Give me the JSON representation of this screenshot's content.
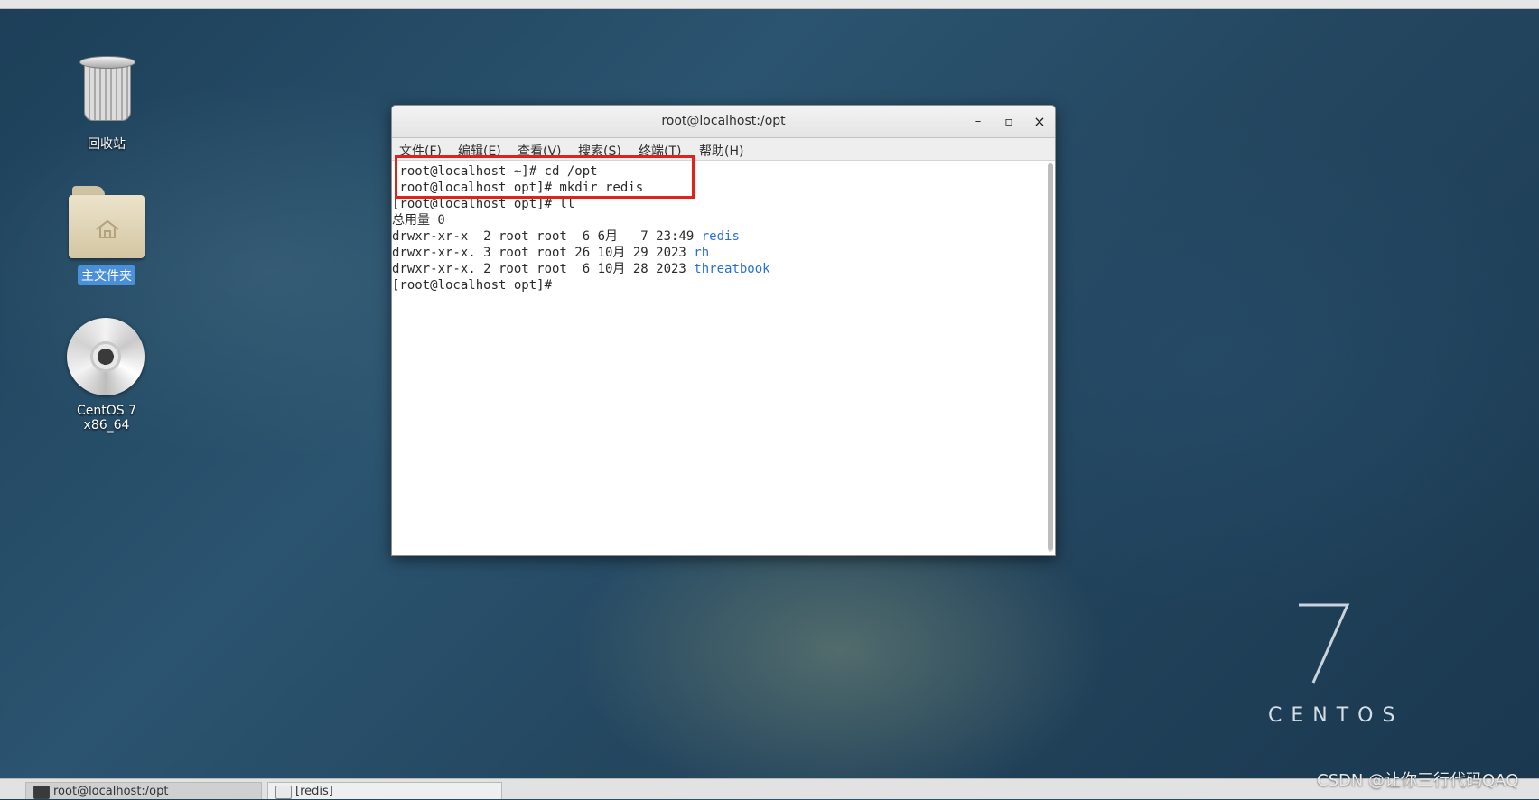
{
  "desktop": {
    "icons": [
      {
        "label": "回收站",
        "icon": "trash-icon"
      },
      {
        "label": "主文件夹",
        "icon": "home-folder-icon"
      },
      {
        "label": "CentOS 7 x86_64",
        "icon": "disc-icon"
      }
    ],
    "brand_number": "7",
    "brand_text": "CENTOS"
  },
  "window": {
    "title": "root@localhost:/opt",
    "controls": {
      "minimize": "–",
      "maximize": "▫",
      "close": "×"
    },
    "menu": [
      "文件(F)",
      "编辑(E)",
      "查看(V)",
      "搜索(S)",
      "终端(T)",
      "帮助(H)"
    ]
  },
  "terminal": {
    "lines": [
      "[root@localhost ~]# cd /opt",
      "[root@localhost opt]# mkdir redis",
      "[root@localhost opt]# ll",
      "总用量 0"
    ],
    "listing": [
      {
        "meta": "drwxr-xr-x  2 root root  6 6月   7 23:49 ",
        "name": "redis"
      },
      {
        "meta": "drwxr-xr-x. 3 root root 26 10月 29 2023 ",
        "name": "rh"
      },
      {
        "meta": "drwxr-xr-x. 2 root root  6 10月 28 2023 ",
        "name": "threatbook"
      }
    ],
    "prompt": "[root@localhost opt]#",
    "accent": "#2a6fd6"
  },
  "taskbar": {
    "tasks": [
      "root@localhost:/opt",
      "[redis]"
    ]
  },
  "watermark": "CSDN @让你三行代码QAQ",
  "colors": {
    "highlight": "#e0221d"
  }
}
